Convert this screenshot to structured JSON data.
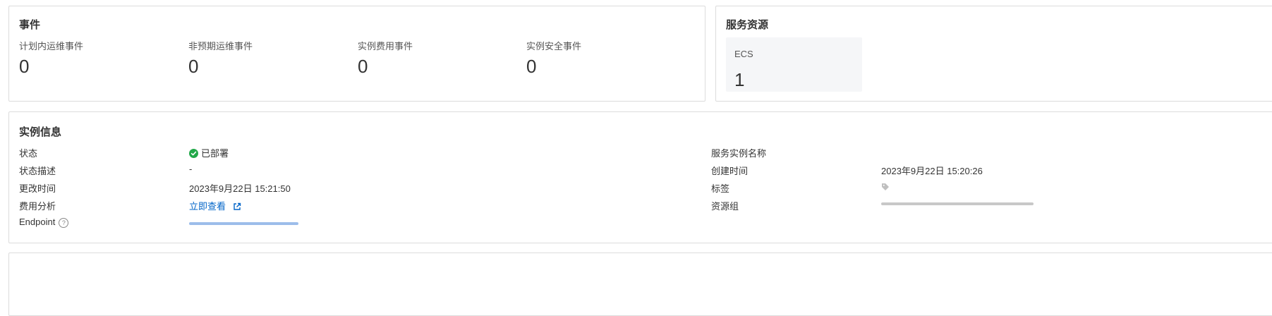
{
  "events": {
    "title": "事件",
    "items": [
      {
        "label": "计划内运维事件",
        "value": "0"
      },
      {
        "label": "非预期运维事件",
        "value": "0"
      },
      {
        "label": "实例费用事件",
        "value": "0"
      },
      {
        "label": "实例安全事件",
        "value": "0"
      }
    ]
  },
  "resources": {
    "title": "服务资源",
    "tiles": [
      {
        "name": "ECS",
        "count": "1"
      }
    ]
  },
  "instance": {
    "title": "实例信息",
    "status_label": "状态",
    "status_value": "已部署",
    "status_desc_label": "状态描述",
    "status_desc_value": "-",
    "modified_label": "更改时间",
    "modified_value": "2023年9月22日 15:21:50",
    "cost_label": "费用分析",
    "cost_link": "立即查看",
    "endpoint_label": "Endpoint",
    "service_name_label": "服务实例名称",
    "created_label": "创建时间",
    "created_value": "2023年9月22日 15:20:26",
    "tags_label": "标签",
    "resource_group_label": "资源组"
  },
  "colors": {
    "status_ok": "#22a849",
    "link": "#0064c8",
    "border": "#dcdcdc"
  }
}
